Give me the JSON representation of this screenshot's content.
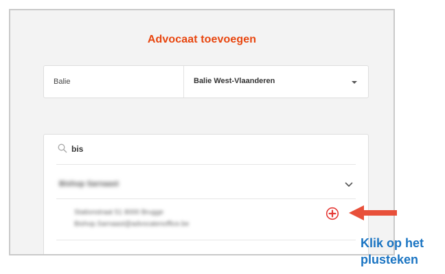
{
  "dialog": {
    "title": "Advocaat toevoegen",
    "colors": {
      "accent": "#e8450e",
      "caption": "#1a74c2"
    }
  },
  "balie_select": {
    "label": "Balie",
    "value": "Balie West-Vlaanderen",
    "icon": "chevron-down-icon"
  },
  "search": {
    "value": "bis",
    "icon": "search-icon"
  },
  "results": {
    "group_name": "Bishop Sarnaast",
    "expand_icon": "chevron-down-icon",
    "entry": {
      "address": "Stationstraat 51 8000 Brugge",
      "email": "Bishop.Sarnaast@advocatenoffice.be",
      "action_icon": "plus-circle-icon"
    }
  },
  "annotation": {
    "line1": "Klik op het",
    "line2": "plusteken",
    "icon": "arrow-left-icon"
  }
}
